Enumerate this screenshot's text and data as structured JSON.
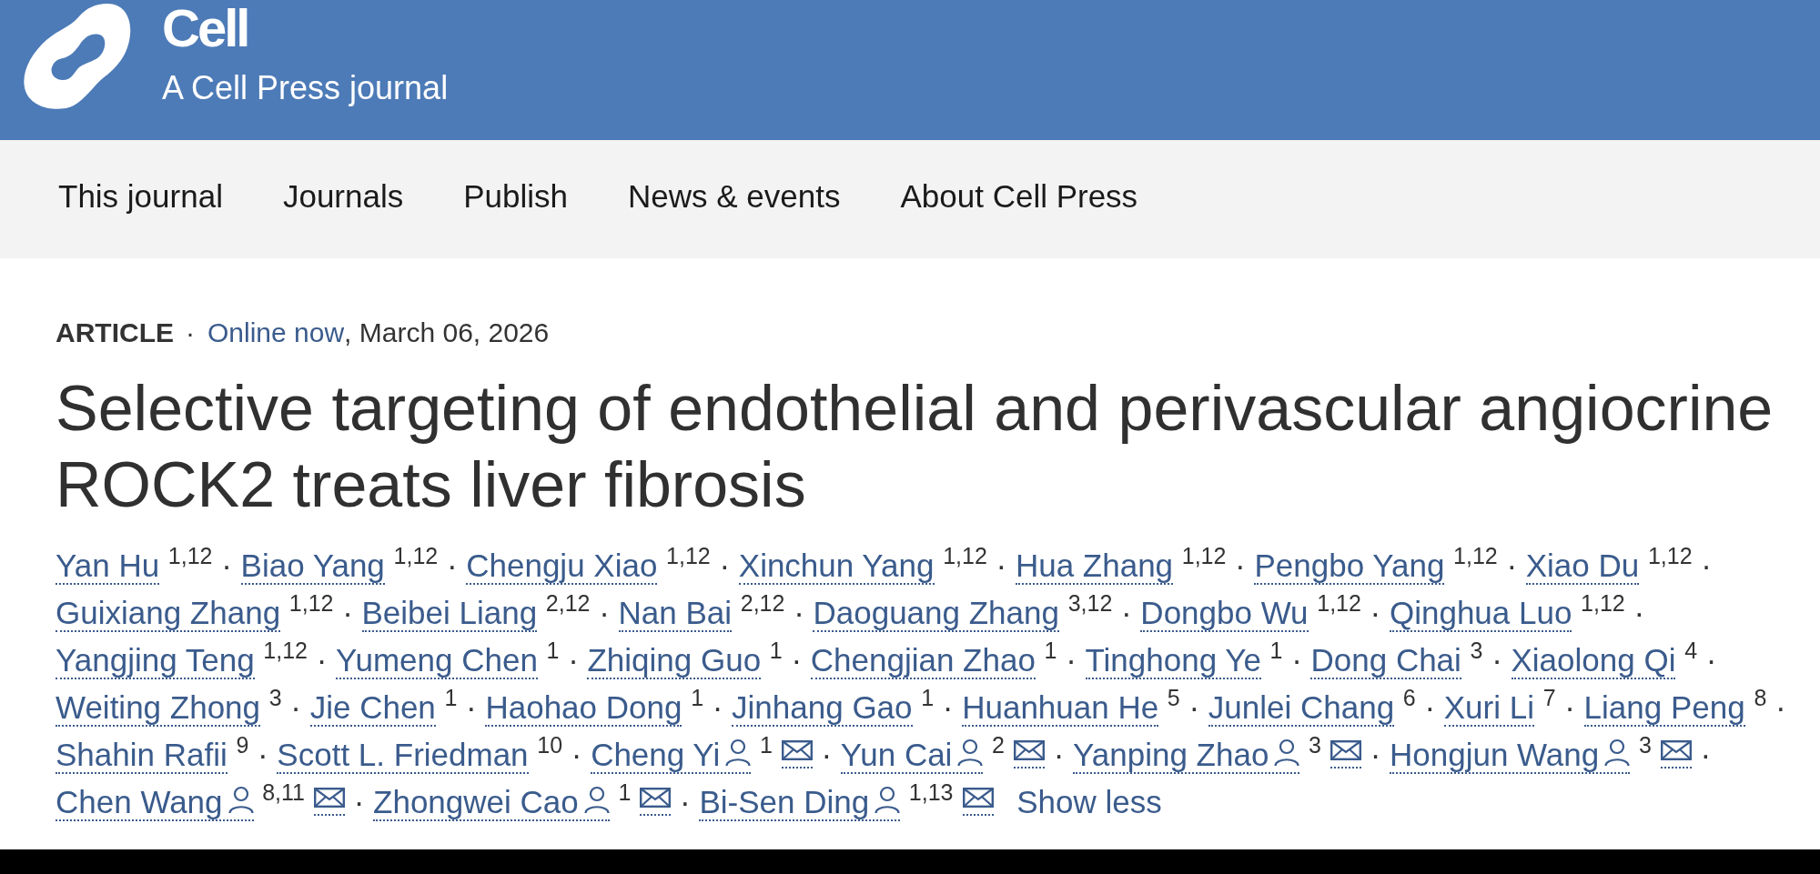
{
  "header": {
    "journal_title": "Cell",
    "tagline": "A Cell Press journal"
  },
  "nav": {
    "items": [
      "This journal",
      "Journals",
      "Publish",
      "News & events",
      "About Cell Press"
    ]
  },
  "article": {
    "type": "ARTICLE",
    "separator": "·",
    "status_link": "Online now",
    "date": ", March 06, 2026",
    "title": "Selective targeting of endothelial and perivascular angiocrine ROCK2 treats liver fibrosis",
    "authors": [
      {
        "name": "Yan Hu",
        "affiliations": "1,12",
        "corresponding": false,
        "separator": "·"
      },
      {
        "name": "Biao Yang",
        "affiliations": "1,12",
        "corresponding": false,
        "separator": "·"
      },
      {
        "name": "Chengju Xiao",
        "affiliations": "1,12",
        "corresponding": false,
        "separator": "·"
      },
      {
        "name": "Xinchun Yang",
        "affiliations": "1,12",
        "corresponding": false,
        "separator": "·"
      },
      {
        "name": "Hua Zhang",
        "affiliations": "1,12",
        "corresponding": false,
        "separator": "·"
      },
      {
        "name": "Pengbo Yang",
        "affiliations": "1,12",
        "corresponding": false,
        "separator": "·"
      },
      {
        "name": "Xiao Du",
        "affiliations": "1,12",
        "corresponding": false,
        "separator": "·"
      },
      {
        "name": "Guixiang Zhang",
        "affiliations": "1,12",
        "corresponding": false,
        "separator": "·"
      },
      {
        "name": "Beibei Liang",
        "affiliations": "2,12",
        "corresponding": false,
        "separator": "·"
      },
      {
        "name": "Nan Bai",
        "affiliations": "2,12",
        "corresponding": false,
        "separator": "·"
      },
      {
        "name": "Daoguang Zhang",
        "affiliations": "3,12",
        "corresponding": false,
        "separator": "·"
      },
      {
        "name": "Dongbo Wu",
        "affiliations": "1,12",
        "corresponding": false,
        "separator": "·"
      },
      {
        "name": "Qinghua Luo",
        "affiliations": "1,12",
        "corresponding": false,
        "separator": "·"
      },
      {
        "name": "Yangjing Teng",
        "affiliations": "1,12",
        "corresponding": false,
        "separator": "·"
      },
      {
        "name": "Yumeng Chen",
        "affiliations": "1",
        "corresponding": false,
        "separator": "·"
      },
      {
        "name": "Zhiqing Guo",
        "affiliations": "1",
        "corresponding": false,
        "separator": "·"
      },
      {
        "name": "Chengjian Zhao",
        "affiliations": "1",
        "corresponding": false,
        "separator": "·"
      },
      {
        "name": "Tinghong Ye",
        "affiliations": "1",
        "corresponding": false,
        "separator": "·"
      },
      {
        "name": "Dong Chai",
        "affiliations": "3",
        "corresponding": false,
        "separator": "·"
      },
      {
        "name": "Xiaolong Qi",
        "affiliations": "4",
        "corresponding": false,
        "separator": "·"
      },
      {
        "name": "Weiting Zhong",
        "affiliations": "3",
        "corresponding": false,
        "separator": "·"
      },
      {
        "name": "Jie Chen",
        "affiliations": "1",
        "corresponding": false,
        "separator": "·"
      },
      {
        "name": "Haohao Dong",
        "affiliations": "1",
        "corresponding": false,
        "separator": "·"
      },
      {
        "name": "Jinhang Gao",
        "affiliations": "1",
        "corresponding": false,
        "separator": "·"
      },
      {
        "name": "Huanhuan He",
        "affiliations": "5",
        "corresponding": false,
        "separator": "·"
      },
      {
        "name": "Junlei Chang",
        "affiliations": "6",
        "corresponding": false,
        "separator": "·"
      },
      {
        "name": "Xuri Li",
        "affiliations": "7",
        "corresponding": false,
        "separator": "·"
      },
      {
        "name": "Liang Peng",
        "affiliations": "8",
        "corresponding": false,
        "separator": "·"
      },
      {
        "name": "Shahin Rafii",
        "affiliations": "9",
        "corresponding": false,
        "separator": "·"
      },
      {
        "name": "Scott L. Friedman",
        "affiliations": "10",
        "corresponding": false,
        "separator": "·"
      },
      {
        "name": "Cheng Yi",
        "affiliations": "1",
        "corresponding": true,
        "separator": "·"
      },
      {
        "name": "Yun Cai",
        "affiliations": "2",
        "corresponding": true,
        "separator": "·"
      },
      {
        "name": "Yanping Zhao",
        "affiliations": "3",
        "corresponding": true,
        "separator": "·"
      },
      {
        "name": "Hongjun Wang",
        "affiliations": "3",
        "corresponding": true,
        "separator": "·"
      },
      {
        "name": "Chen Wang",
        "affiliations": "8,11",
        "corresponding": true,
        "separator": "·"
      },
      {
        "name": "Zhongwei Cao",
        "affiliations": "1",
        "corresponding": true,
        "separator": "·"
      },
      {
        "name": "Bi-Sen Ding",
        "affiliations": "1,13",
        "corresponding": true
      }
    ],
    "toggle": "Show less"
  }
}
